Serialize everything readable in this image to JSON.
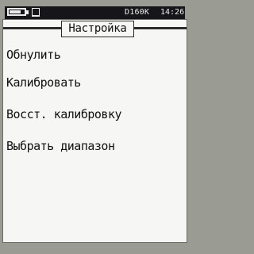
{
  "status_bar": {
    "battery_level": 0.75,
    "device_model": "D160K",
    "time": "14:26",
    "icons": [
      "battery-icon",
      "storage-icon"
    ]
  },
  "screen": {
    "title": "Настройка",
    "menu": [
      {
        "label": "Обнулить"
      },
      {
        "label": "Калибровать"
      },
      {
        "label": "Восст. калибровку"
      },
      {
        "label": "Выбрать диапазон"
      }
    ]
  },
  "colors": {
    "background": "#9a9c93",
    "status_bar": "#16161a",
    "screen": "#f6f6f4",
    "text": "#111111"
  }
}
